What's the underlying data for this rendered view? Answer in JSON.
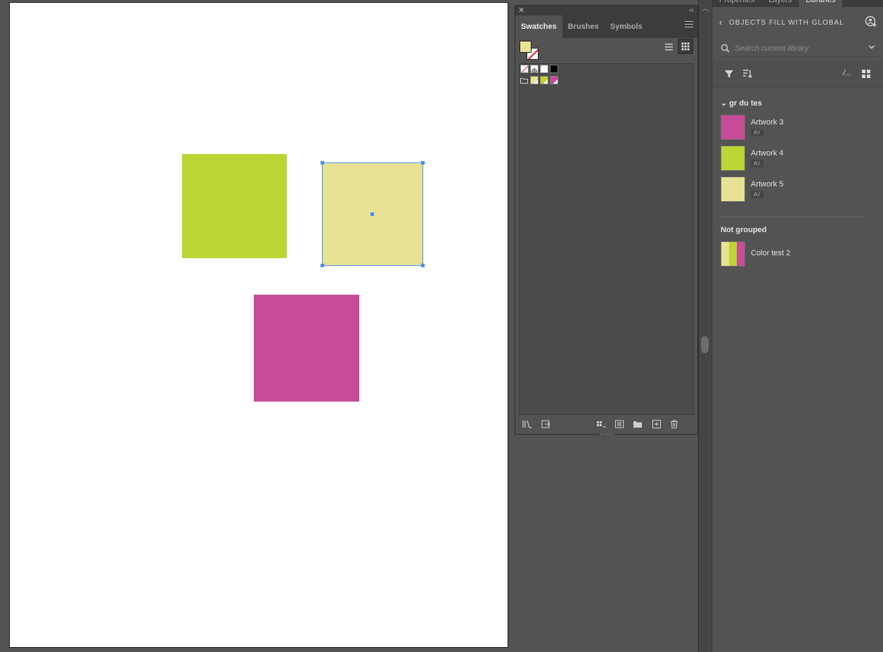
{
  "swatches_panel": {
    "close_glyph": "✕",
    "collapse_glyph": "‹‹",
    "tabs": [
      {
        "label": "Swatches"
      },
      {
        "label": "Brushes"
      },
      {
        "label": "Symbols"
      }
    ],
    "fill_color": "#e8e294"
  },
  "libraries_panel": {
    "top_tabs": [
      "Properties",
      "Layers",
      "Libraries"
    ],
    "back_glyph": "‹",
    "library_name": "OBJECTS FILL WITH GLOBAL",
    "search_placeholder": "Search current library",
    "group": {
      "chevron": "⌄",
      "title": "gr du tes",
      "items": [
        {
          "name": "Artwork 3",
          "badge": "AI",
          "color": "#c84b98"
        },
        {
          "name": "Artwork 4",
          "badge": "AI",
          "color": "#bcd434"
        },
        {
          "name": "Artwork 5",
          "badge": "AI",
          "color": "#e8e294"
        }
      ]
    },
    "ungrouped": {
      "title": "Not grouped",
      "items": [
        {
          "name": "Color test 2",
          "colors": [
            "#e8e294",
            "#bcd434",
            "#c84b98"
          ]
        }
      ]
    },
    "toolbar_text": "/..."
  },
  "canvas": {
    "shapes": [
      {
        "name": "green-square",
        "color": "#bcd434"
      },
      {
        "name": "yellow-square",
        "color": "#e8e294",
        "selected": true
      },
      {
        "name": "pink-square",
        "color": "#c84b98"
      }
    ]
  },
  "colors": {
    "panel_bg": "#535353",
    "panel_dark": "#3c3c3c",
    "selection": "#4a8ef0",
    "accent_none": "#d6202e"
  }
}
